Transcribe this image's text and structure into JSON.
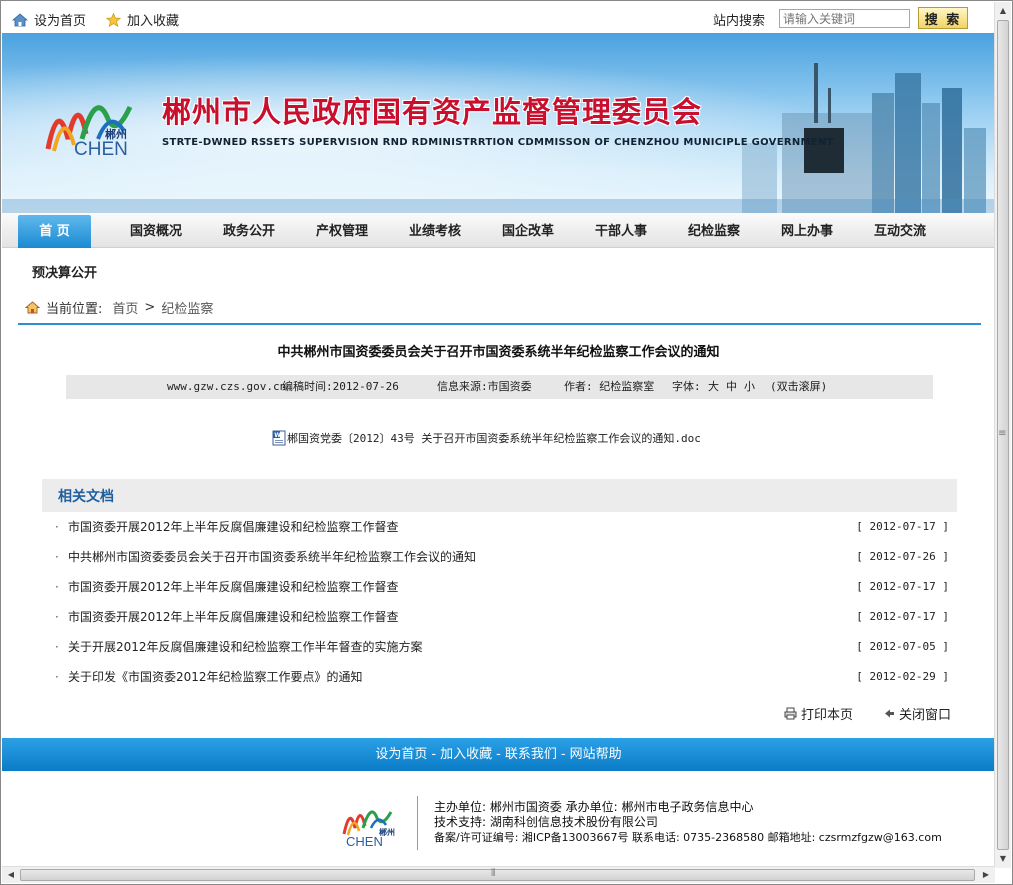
{
  "topbar": {
    "set_home": "设为首页",
    "bookmark": "加入收藏",
    "search_label": "站内搜索",
    "search_placeholder": "请输入关键词",
    "search_button": "搜 索"
  },
  "banner": {
    "title": "郴州市人民政府国有资产监督管理委员会",
    "subtitle": "STRTE-DWNED RSSETS SUPERVISION RND RDMINISTRRTION CDMMISSON OF CHENZHOU MUNICIPLE GOVERNMENT",
    "logo_text": "CHEN",
    "logo_city": "郴州"
  },
  "nav": {
    "tabs": [
      {
        "label": "首 页",
        "active": true
      },
      {
        "label": "国资概况"
      },
      {
        "label": "政务公开"
      },
      {
        "label": "产权管理"
      },
      {
        "label": "业绩考核"
      },
      {
        "label": "国企改革"
      },
      {
        "label": "干部人事"
      },
      {
        "label": "纪检监察"
      },
      {
        "label": "网上办事"
      },
      {
        "label": "互动交流"
      }
    ],
    "sub": "预决算公开"
  },
  "breadcrumb": {
    "label": "当前位置:",
    "home": "首页",
    "sep": ">",
    "current": "纪检监察"
  },
  "article": {
    "title": "中共郴州市国资委委员会关于召开市国资委系统半年纪检监察工作会议的通知",
    "site": "www.gzw.czs.gov.cn",
    "edit_time": "编稿时间:2012-07-26",
    "source": "信息来源:市国资委",
    "author": "作者: 纪检监察室",
    "font_label": "字体:",
    "font_large": "大",
    "font_medium": "中",
    "font_small": "小",
    "autoscroll": "(双击滚屏)",
    "attachment": "郴国资党委〔2012〕43号 关于召开市国资委系统半年纪检监察工作会议的通知.doc"
  },
  "related": {
    "heading": "相关文档",
    "items": [
      {
        "title": "市国资委开展2012年上半年反腐倡廉建设和纪检监察工作督查",
        "date": "[ 2012-07-17 ]"
      },
      {
        "title": "中共郴州市国资委委员会关于召开市国资委系统半年纪检监察工作会议的通知",
        "date": "[ 2012-07-26 ]"
      },
      {
        "title": "市国资委开展2012年上半年反腐倡廉建设和纪检监察工作督查",
        "date": "[ 2012-07-17 ]"
      },
      {
        "title": "市国资委开展2012年上半年反腐倡廉建设和纪检监察工作督查",
        "date": "[ 2012-07-17 ]"
      },
      {
        "title": "关于开展2012年反腐倡廉建设和纪检监察工作半年督查的实施方案",
        "date": "[ 2012-07-05 ]"
      },
      {
        "title": "关于印发《市国资委2012年纪检监察工作要点》的通知",
        "date": "[ 2012-02-29 ]"
      }
    ]
  },
  "actions": {
    "print": "打印本页",
    "close": "关闭窗口"
  },
  "footer": {
    "links": [
      "设为首页",
      "加入收藏",
      "联系我们",
      "网站帮助"
    ],
    "separator": "-",
    "host": "主办单位: 郴州市国资委   承办单位: 郴州市电子政务信息中心",
    "tech": "技术支持: 湖南科创信息技术股份有限公司",
    "icp": "备案/许可证编号: 湘ICP备13003667号 联系电话: 0735-2368580 邮箱地址: czsrmzfgzw@163.com",
    "logo_text": "CHEN",
    "logo_city": "郴州"
  },
  "colors": {
    "accent": "#2c8ed4",
    "title_red": "#c8102e",
    "footer_blue": "#0b7cc7"
  }
}
